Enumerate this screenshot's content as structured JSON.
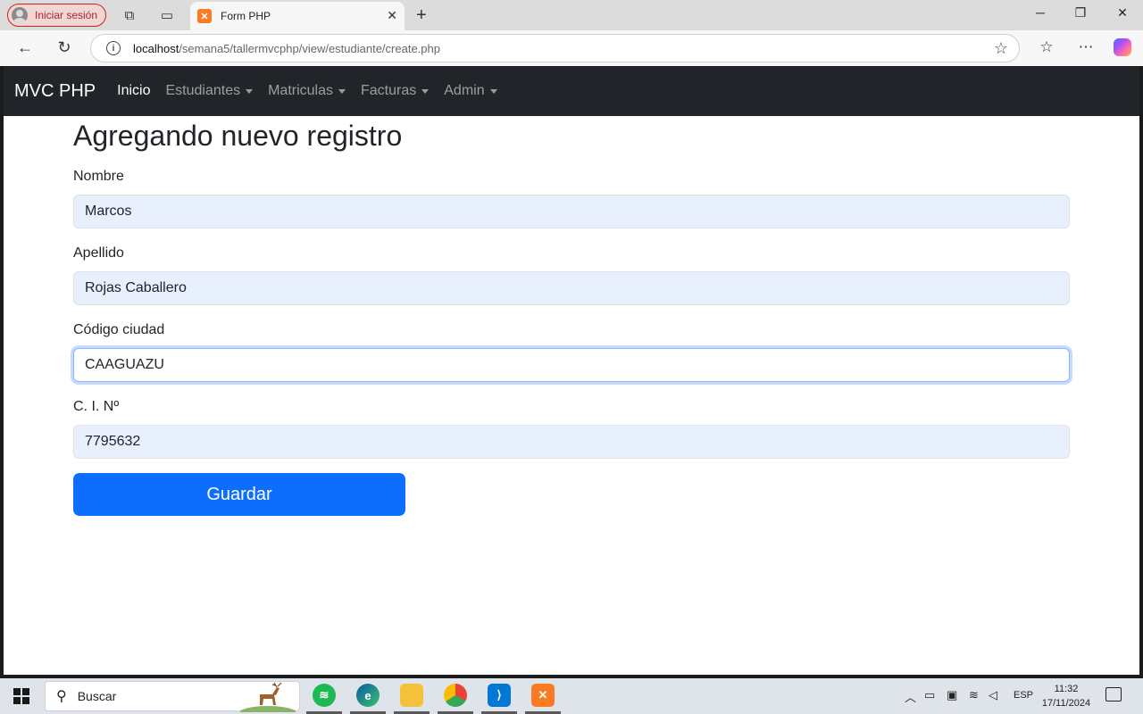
{
  "browser": {
    "profile_label": "Iniciar sesión",
    "tab_title": "Form PHP",
    "url_host": "localhost",
    "url_path": "/semana5/tallermvcphp/view/estudiante/create.php"
  },
  "navbar": {
    "brand": "MVC PHP",
    "items": [
      {
        "label": "Inicio",
        "active": true,
        "dropdown": false
      },
      {
        "label": "Estudiantes",
        "active": false,
        "dropdown": true
      },
      {
        "label": "Matriculas",
        "active": false,
        "dropdown": true
      },
      {
        "label": "Facturas",
        "active": false,
        "dropdown": true
      },
      {
        "label": "Admin",
        "active": false,
        "dropdown": true
      }
    ]
  },
  "form": {
    "title": "Agregando nuevo registro",
    "fields": [
      {
        "label": "Nombre",
        "value": "Marcos"
      },
      {
        "label": "Apellido",
        "value": "Rojas Caballero"
      },
      {
        "label": "Código ciudad",
        "value": "CAAGUAZU"
      },
      {
        "label": "C. I. Nº",
        "value": "7795632"
      }
    ],
    "submit_label": "Guardar"
  },
  "taskbar": {
    "search_label": "Buscar",
    "language": "ESP",
    "time": "11:32",
    "date": "17/11/2024",
    "apps": [
      "spotify-icon",
      "edge-icon",
      "file-explorer-icon",
      "chrome-icon",
      "vscode-icon",
      "xampp-icon"
    ]
  },
  "colors": {
    "navbar_bg": "#212529",
    "primary": "#0d6efd",
    "autofill_bg": "#e8f0fe",
    "focus_border": "#86b7fe"
  }
}
